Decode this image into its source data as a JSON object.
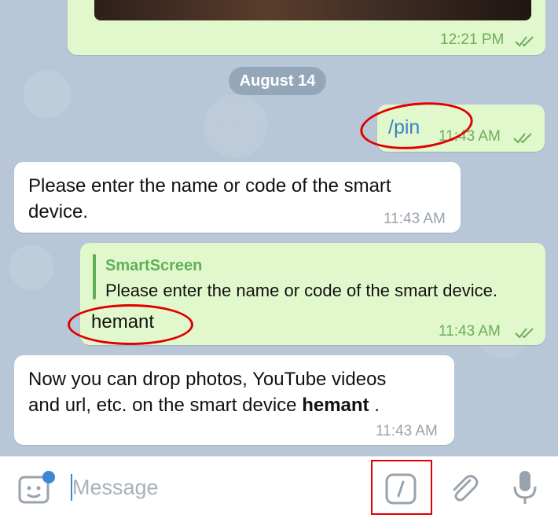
{
  "messages": {
    "photo_msg": {
      "time": "12:21 PM"
    },
    "date_separator": "August 14",
    "pin_msg": {
      "text": "/pin",
      "time": "11:43 AM"
    },
    "bot_prompt": {
      "line1": "Please enter the name or code of the smart",
      "line2": "device.",
      "time": "11:43 AM"
    },
    "reply_msg": {
      "reply_author": "SmartScreen",
      "reply_text": "Please enter the name or code of the smart device.",
      "text": "hemant",
      "time": "11:43 AM"
    },
    "bot_confirm": {
      "line1": "Now you can drop photos, YouTube videos",
      "line2_prefix": "and url, etc. on the smart device ",
      "device_name": "hemant",
      "line2_suffix": " .",
      "time": "11:43 AM"
    }
  },
  "input": {
    "placeholder": "Message"
  },
  "icons": [
    "sticker-icon",
    "bot-command-icon",
    "attach-icon",
    "microphone-icon",
    "double-check-icon"
  ],
  "colors": {
    "outgoing_bubble": "#e1f8cc",
    "incoming_bubble": "#ffffff",
    "accent": "#3c80c6",
    "highlight": "#e00000"
  }
}
